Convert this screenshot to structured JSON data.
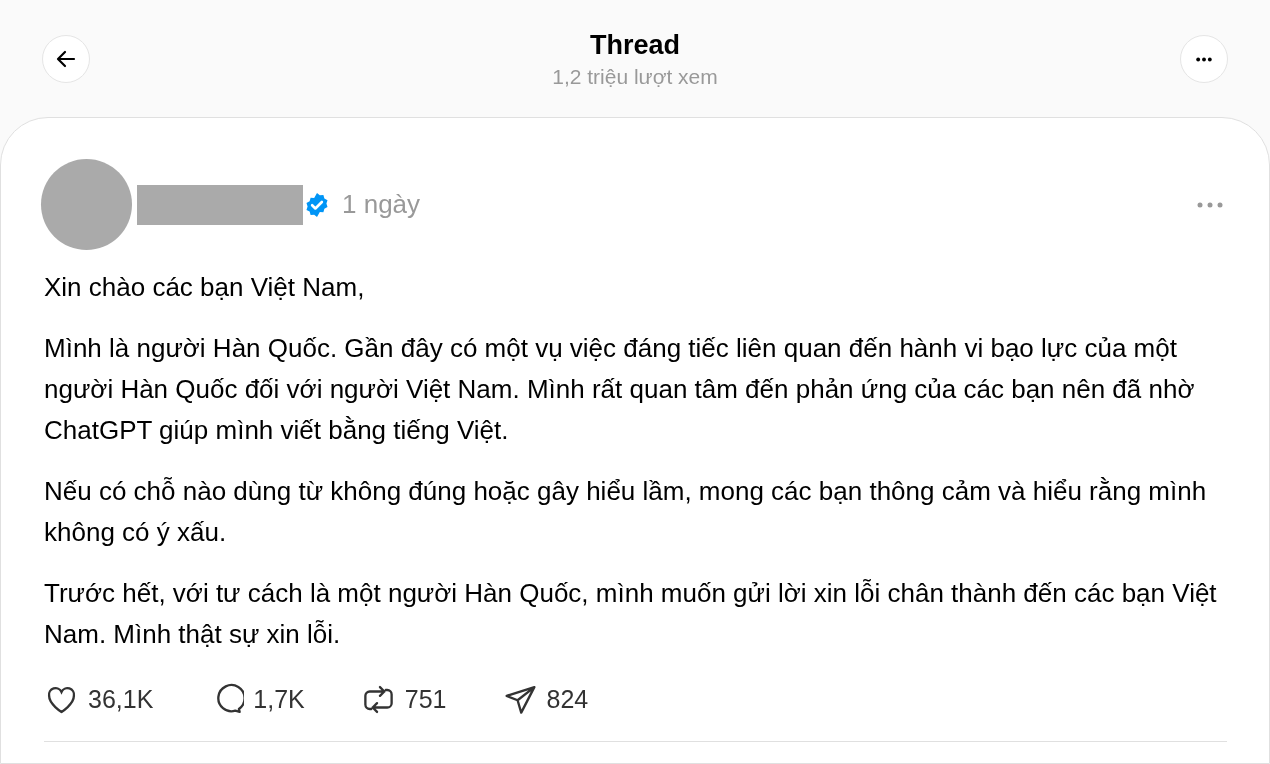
{
  "header": {
    "title": "Thread",
    "subtitle": "1,2 triệu lượt xem"
  },
  "post": {
    "author": {
      "verified": true
    },
    "time": "1 ngày",
    "paragraphs": [
      "Xin chào các bạn Việt Nam,",
      "Mình là người Hàn Quốc. Gần đây có một vụ việc đáng tiếc liên quan đến hành vi bạo lực của một người Hàn Quốc đối với người Việt Nam. Mình rất quan tâm đến phản ứng của các bạn nên đã nhờ ChatGPT giúp mình viết bằng tiếng Việt.",
      "Nếu có chỗ nào dùng từ không đúng hoặc gây hiểu lầm, mong các bạn thông cảm và hiểu rằng mình không có ý xấu.",
      "Trước hết, với tư cách là một người Hàn Quốc, mình muốn gửi lời xin lỗi chân thành đến các bạn Việt Nam. Mình thật sự xin lỗi."
    ],
    "actions": [
      {
        "kind": "like",
        "count": "36,1K"
      },
      {
        "kind": "reply",
        "count": "1,7K"
      },
      {
        "kind": "repost",
        "count": "751"
      },
      {
        "kind": "share",
        "count": "824"
      }
    ]
  }
}
